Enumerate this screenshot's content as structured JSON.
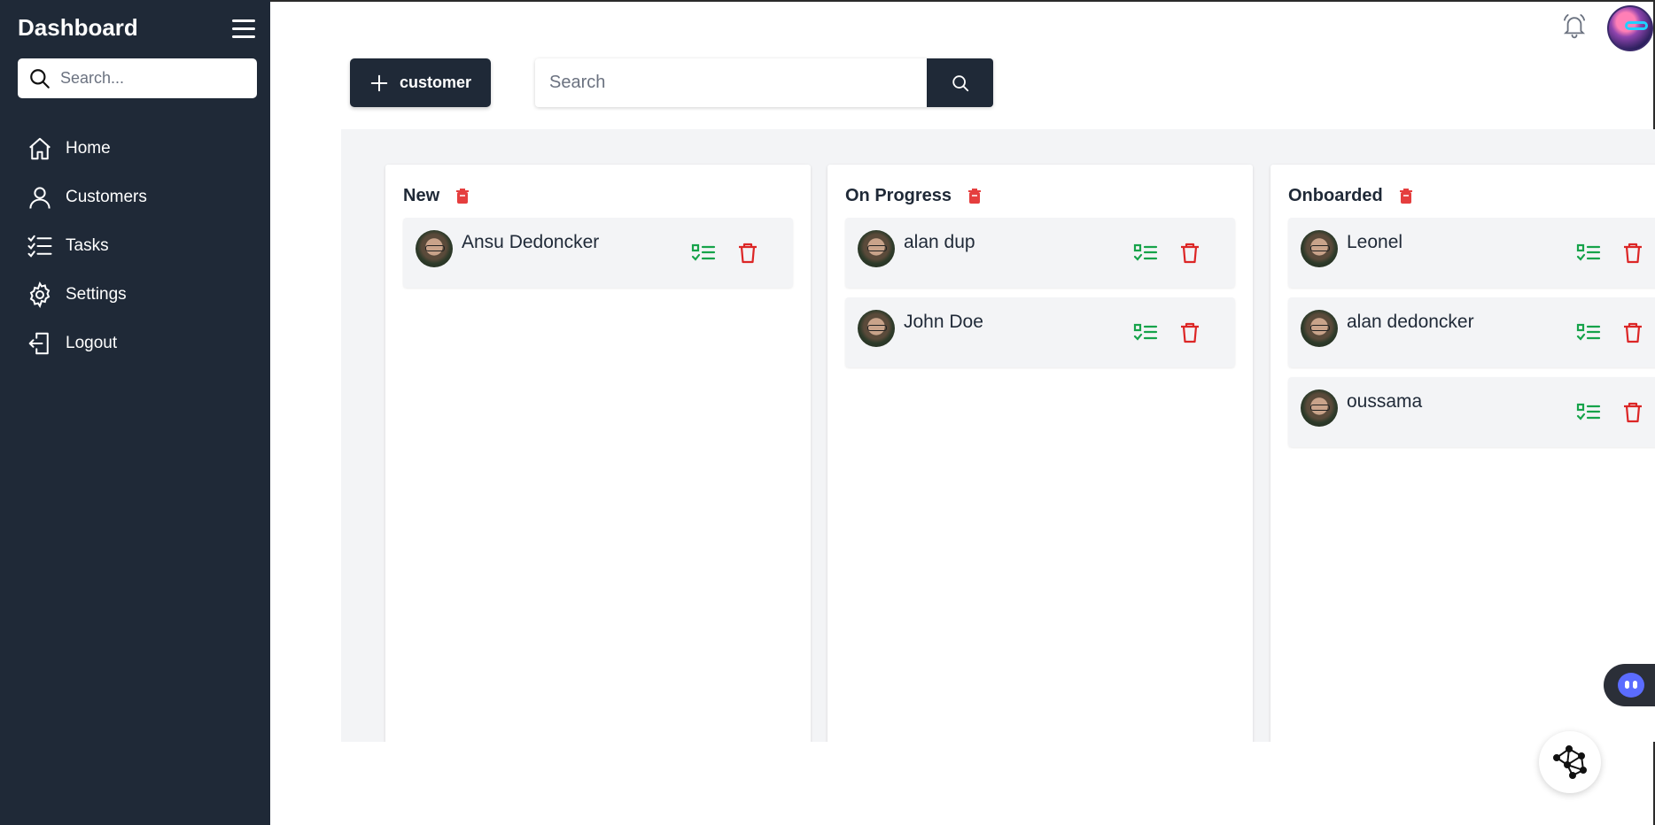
{
  "sidebar": {
    "brand": "Dashboard",
    "search_placeholder": "Search...",
    "items": [
      {
        "label": "Home",
        "icon": "home-icon"
      },
      {
        "label": "Customers",
        "icon": "user-icon"
      },
      {
        "label": "Tasks",
        "icon": "checklist-icon"
      },
      {
        "label": "Settings",
        "icon": "gear-icon"
      },
      {
        "label": "Logout",
        "icon": "logout-icon"
      }
    ]
  },
  "toolbar": {
    "add_label": "customer",
    "search_placeholder": "Search"
  },
  "board": {
    "columns": [
      {
        "title": "New",
        "cards": [
          {
            "name": "Ansu Dedoncker"
          }
        ]
      },
      {
        "title": "On Progress",
        "cards": [
          {
            "name": "alan dup"
          },
          {
            "name": "John Doe"
          }
        ]
      },
      {
        "title": "Onboarded",
        "cards": [
          {
            "name": "Leonel"
          },
          {
            "name": "alan dedoncker"
          },
          {
            "name": "oussama"
          }
        ]
      }
    ]
  },
  "colors": {
    "sidebar_bg": "#1f2937",
    "board_bg": "#f3f4f6",
    "task_green": "#16a34a",
    "delete_red": "#dc2626"
  }
}
